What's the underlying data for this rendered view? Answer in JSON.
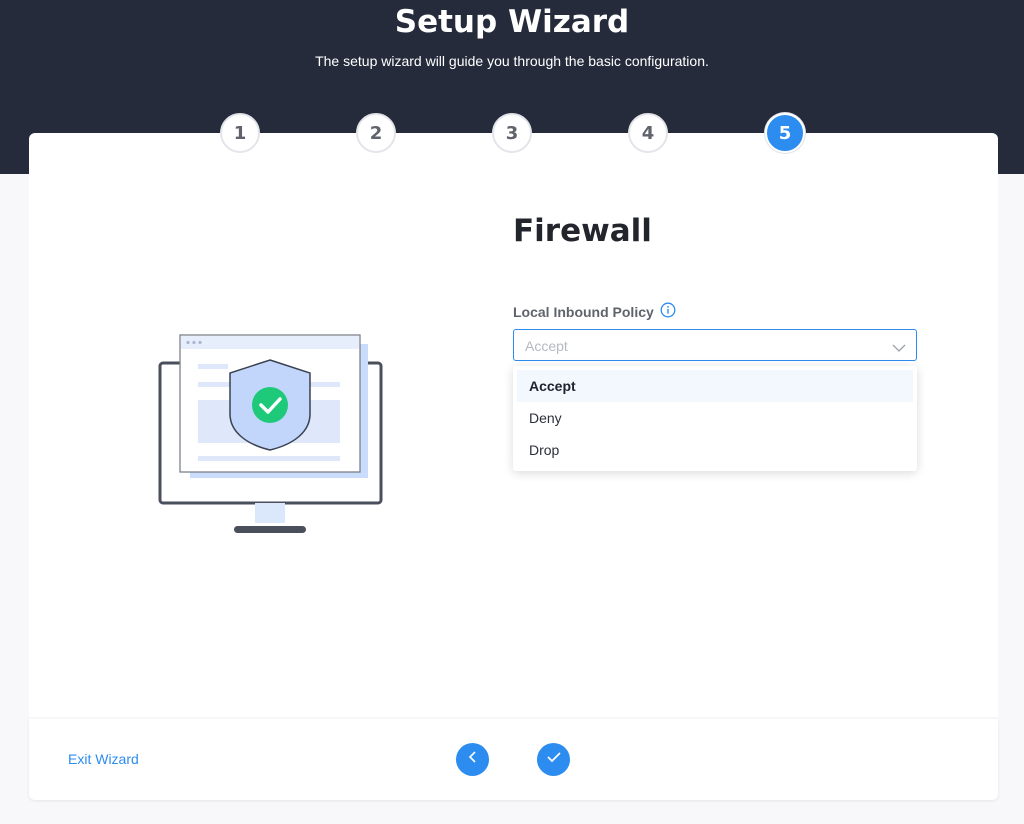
{
  "header": {
    "title": "Setup Wizard",
    "subtitle": "The setup wizard will guide you through the basic configuration."
  },
  "steps": [
    {
      "label": "1",
      "state": "complete"
    },
    {
      "label": "2",
      "state": "complete"
    },
    {
      "label": "3",
      "state": "complete"
    },
    {
      "label": "4",
      "state": "complete"
    },
    {
      "label": "5",
      "state": "active"
    }
  ],
  "main": {
    "title": "Firewall",
    "field_label": "Local Inbound Policy",
    "info_icon": "info-circle-icon",
    "select_value": "Accept",
    "options": [
      {
        "label": "Accept",
        "selected": true
      },
      {
        "label": "Deny",
        "selected": false
      },
      {
        "label": "Drop",
        "selected": false
      }
    ]
  },
  "footer": {
    "exit_label": "Exit Wizard",
    "back_icon": "chevron-left-icon",
    "finish_icon": "checkmark-icon"
  },
  "colors": {
    "header_bg": "#252b3b",
    "accent": "#2d8cf0",
    "success": "#1ec979"
  }
}
